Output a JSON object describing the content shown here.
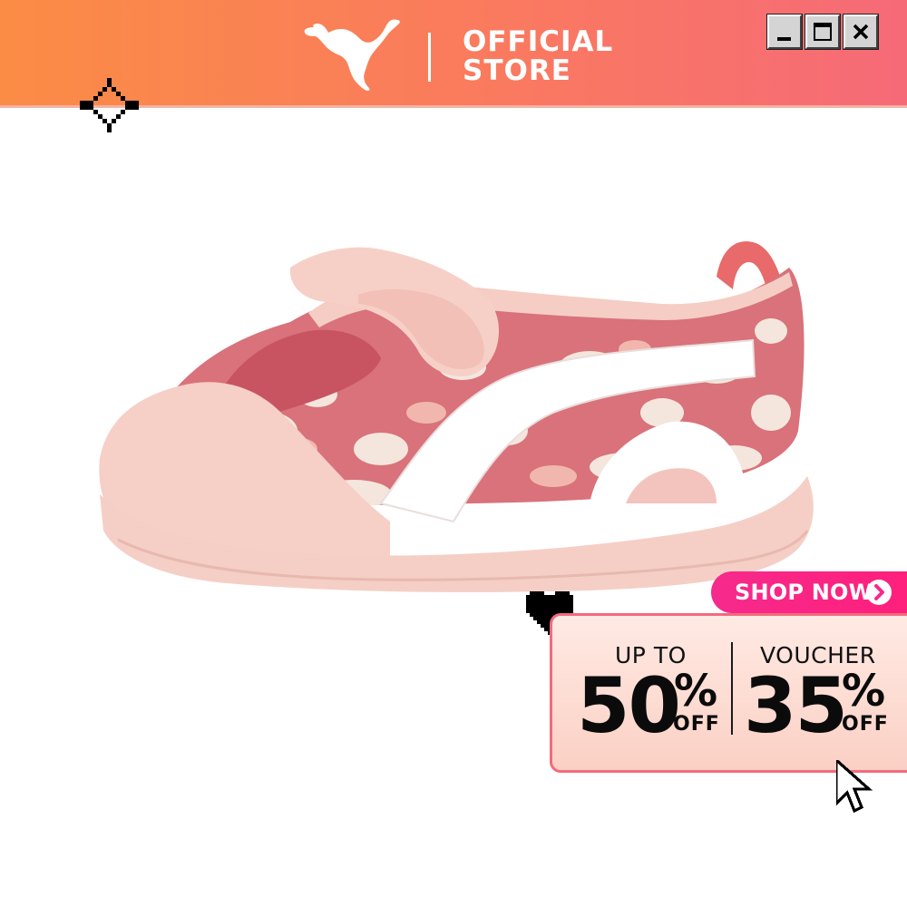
{
  "header": {
    "brand": "PUMA",
    "store_line1": "OFFICIAL",
    "store_line2": "STORE",
    "background_colors": [
      "#fb8c45",
      "#f66a78"
    ]
  },
  "window_controls": {
    "minimize_icon": "minimize-icon",
    "maximize_icon": "maximize-icon",
    "close_icon": "close-icon"
  },
  "product": {
    "description_icon": "pink-camo-kids-sandal"
  },
  "cta": {
    "shop_now_label": "SHOP NOW",
    "icon": "chevron-right-icon",
    "color": "#f62a8c"
  },
  "promo": {
    "left_label": "UP TO",
    "left_value": "50",
    "left_unit": "%",
    "left_suffix": "OFF",
    "right_label": "VOUCHER",
    "right_value": "35",
    "right_unit": "%",
    "right_suffix": "OFF",
    "border_color": "#f26b7d"
  }
}
